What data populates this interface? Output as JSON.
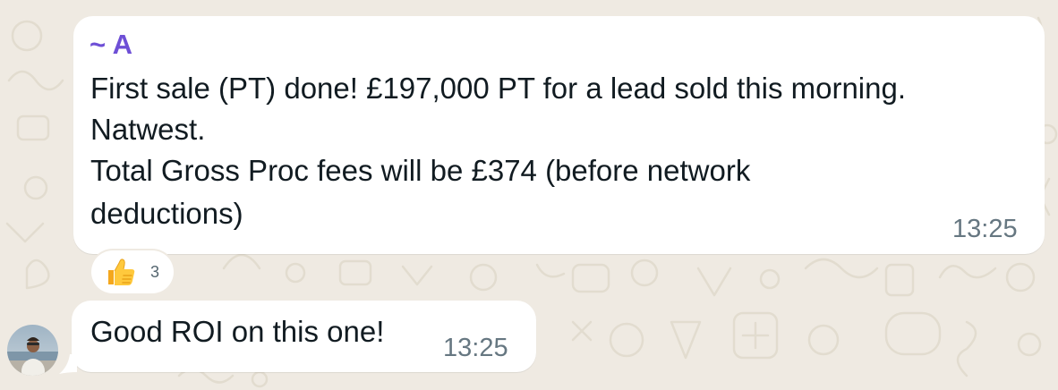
{
  "chat": {
    "messages": [
      {
        "sender": "~ A",
        "lines": [
          "First sale (PT) done! £197,000 PT for a lead sold this morning.",
          "Natwest.",
          "Total Gross Proc fees will be £374 (before network",
          "deductions)"
        ],
        "time": "13:25",
        "reaction": {
          "emoji": "thumbs-up-icon",
          "count": "3"
        }
      },
      {
        "text": "Good ROI on this one!",
        "time": "13:25",
        "avatar": "avatar"
      }
    ]
  },
  "colors": {
    "background": "#efeae2",
    "bubble": "#ffffff",
    "sender_name": "#6e4fd6",
    "message_text": "#111b21",
    "timestamp": "#667781"
  }
}
